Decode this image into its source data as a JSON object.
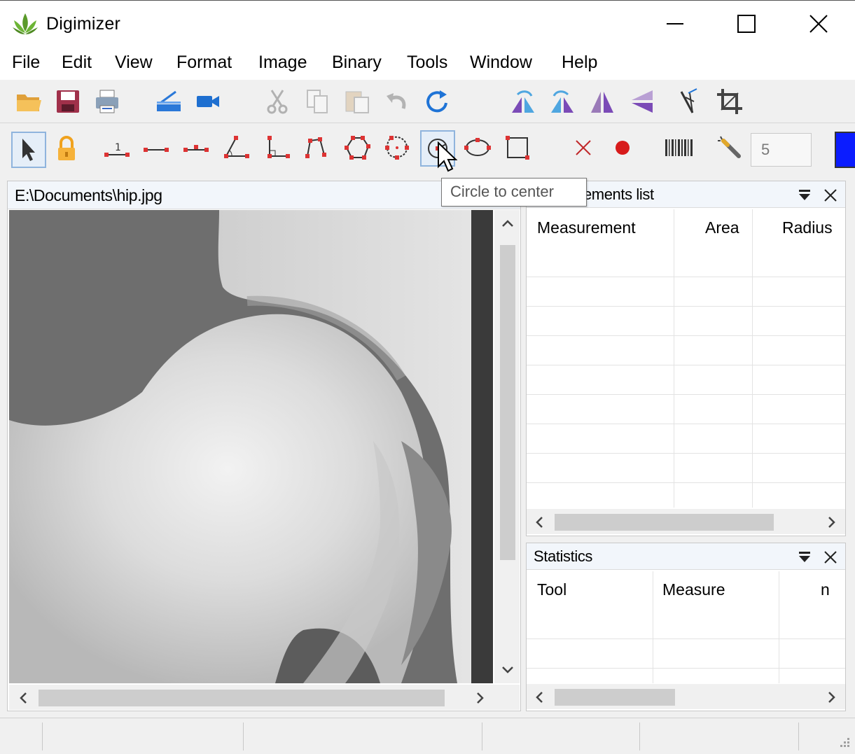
{
  "window": {
    "title": "Digimizer",
    "controls": [
      "minimize",
      "maximize",
      "close"
    ]
  },
  "menu": [
    "File",
    "Edit",
    "View",
    "Format",
    "Image",
    "Binary",
    "Tools",
    "Window",
    "Help"
  ],
  "toolbar_file": [
    "open-folder-icon",
    "save-icon",
    "print-icon",
    "scanner-icon",
    "video-camera-icon",
    "cut-icon",
    "copy-icon",
    "paste-icon",
    "undo-icon",
    "redo-icon",
    "rotate-left-icon",
    "rotate-right-icon",
    "flip-horizontal-icon",
    "flip-vertical-icon",
    "calibrate-icon",
    "crop-icon"
  ],
  "toolbar_measure": {
    "tools": [
      "select-pointer-icon",
      "lock-icon",
      "marker-length-icon",
      "line-icon",
      "multi-segment-line-icon",
      "angle-icon",
      "right-angle-icon",
      "polyline-icon",
      "polygon-icon",
      "closed-curve-icon",
      "circle-to-center-icon",
      "ellipse-icon",
      "rectangle-icon",
      "delete-marker-icon",
      "point-icon",
      "barcode-icon",
      "wand-icon"
    ],
    "selected_tool": "circle-to-center-icon",
    "line_width": "5",
    "color": "#0b1cff"
  },
  "tooltip": "Circle to center",
  "image_window": {
    "path": "E:\\Documents\\hip.jpg"
  },
  "measurements_panel": {
    "title": "Measurements list",
    "columns": [
      "Measurement",
      "Area",
      "Radius"
    ]
  },
  "statistics_panel": {
    "title": "Statistics",
    "columns": [
      "Tool",
      "Measure",
      "n"
    ]
  }
}
